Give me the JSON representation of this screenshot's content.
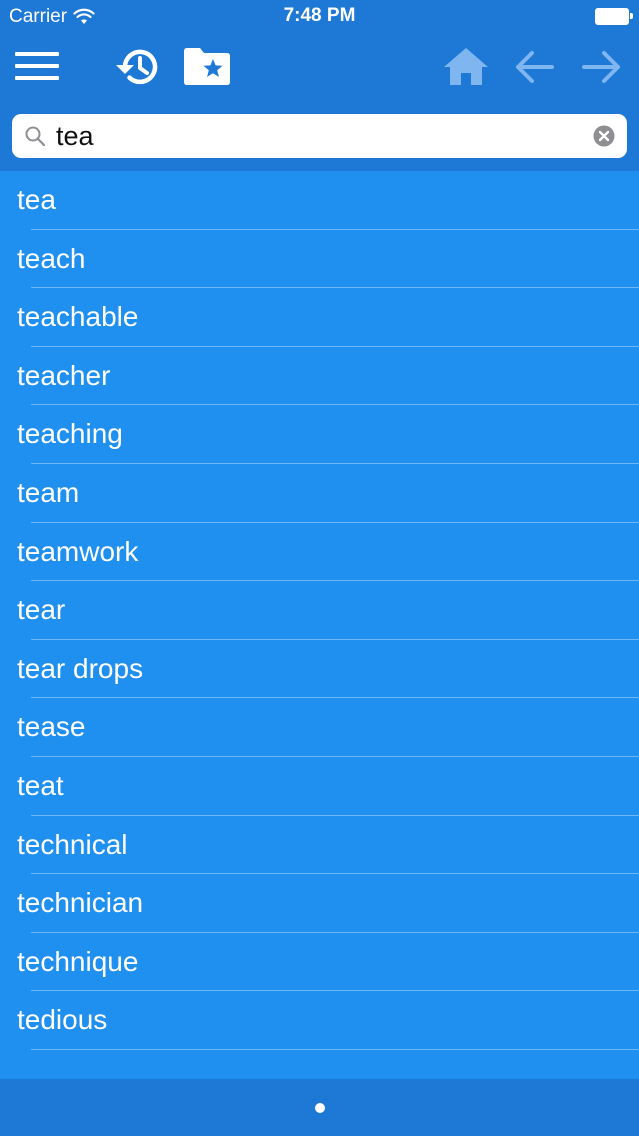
{
  "status_bar": {
    "carrier": "Carrier",
    "time": "7:48 PM"
  },
  "toolbar": {
    "icons": [
      "menu-icon",
      "history-icon",
      "favorites-folder-icon",
      "home-icon",
      "back-arrow-icon",
      "forward-arrow-icon"
    ]
  },
  "search": {
    "value": "tea",
    "placeholder": ""
  },
  "results": [
    "tea",
    "teach",
    "teachable",
    "teacher",
    "teaching",
    "team",
    "teamwork",
    "tear",
    "tear drops",
    "tease",
    "teat",
    "technical",
    "technician",
    "technique",
    "tedious"
  ],
  "pager": {
    "current": 1,
    "total": 1
  },
  "colors": {
    "header": "#1d78d6",
    "list_background": "#1f8ff0",
    "disabled_icon": "#7fb6f0",
    "text": "#ffffff"
  }
}
